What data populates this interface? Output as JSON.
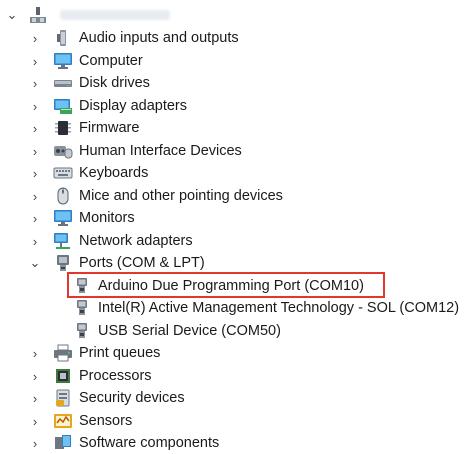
{
  "root": {
    "expand_glyph": "⌄",
    "icon": "computer-tree-icon"
  },
  "colors": {
    "highlight_border": "#e2362f",
    "tree_text": "#1a1a1a"
  },
  "categories": [
    {
      "label": "Audio inputs and outputs",
      "icon": "speaker-icon",
      "expanded": false
    },
    {
      "label": "Computer",
      "icon": "monitor-icon",
      "expanded": false
    },
    {
      "label": "Disk drives",
      "icon": "disk-drive-icon",
      "expanded": false
    },
    {
      "label": "Display adapters",
      "icon": "display-adapter-icon",
      "expanded": false
    },
    {
      "label": "Firmware",
      "icon": "chip-icon",
      "expanded": false
    },
    {
      "label": "Human Interface Devices",
      "icon": "hid-icon",
      "expanded": false
    },
    {
      "label": "Keyboards",
      "icon": "keyboard-icon",
      "expanded": false
    },
    {
      "label": "Mice and other pointing devices",
      "icon": "mouse-icon",
      "expanded": false
    },
    {
      "label": "Monitors",
      "icon": "monitor-icon",
      "expanded": false
    },
    {
      "label": "Network adapters",
      "icon": "network-icon",
      "expanded": false
    },
    {
      "label": "Ports (COM & LPT)",
      "icon": "port-icon",
      "expanded": true
    }
  ],
  "ports_children": [
    {
      "label": "Arduino Due Programming Port (COM10)",
      "icon": "port-connector-icon",
      "highlighted": true
    },
    {
      "label": "Intel(R) Active Management Technology - SOL (COM12)",
      "icon": "port-connector-icon",
      "highlighted": false
    },
    {
      "label": "USB Serial Device (COM50)",
      "icon": "port-connector-icon",
      "highlighted": false
    }
  ],
  "categories_after": [
    {
      "label": "Print queues",
      "icon": "printer-icon"
    },
    {
      "label": "Processors",
      "icon": "processor-icon"
    },
    {
      "label": "Security devices",
      "icon": "security-icon"
    },
    {
      "label": "Sensors",
      "icon": "sensor-icon"
    },
    {
      "label": "Software components",
      "icon": "software-icon"
    }
  ],
  "glyphs": {
    "collapsed": "›",
    "expanded": "⌄"
  }
}
